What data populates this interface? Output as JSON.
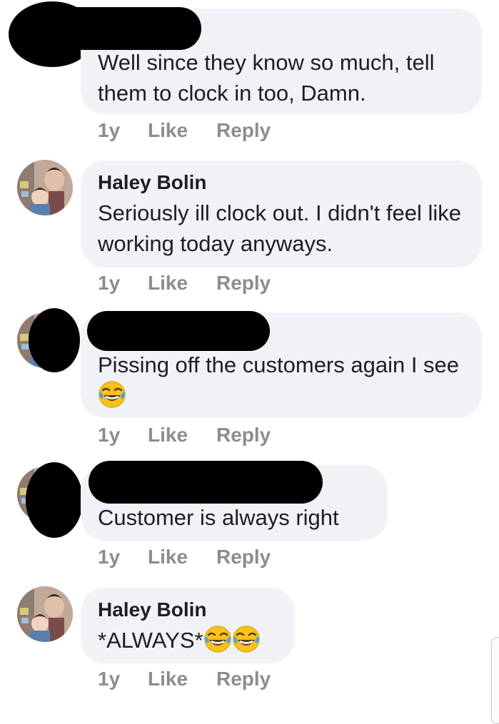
{
  "comments": [
    {
      "name": "",
      "text": "Well since they know so much, tell them to clock in too, Damn.",
      "time": "1y",
      "like": "Like",
      "reply": "Reply"
    },
    {
      "name": "Haley Bolin",
      "text": "Seriously ill clock out. I didn't feel like working today anyways.",
      "time": "1y",
      "like": "Like",
      "reply": "Reply"
    },
    {
      "name": "",
      "text": "Pissing off the customers again I see",
      "emoji": "tears-of-joy-emoji",
      "time": "1y",
      "like": "Like",
      "reply": "Reply"
    },
    {
      "name": "",
      "text": "Customer is always right",
      "time": "1y",
      "like": "Like",
      "reply": "Reply"
    },
    {
      "name": "Haley Bolin",
      "text": "*ALWAYS*",
      "emoji": "tears-of-joy-emoji",
      "time": "1y",
      "like": "Like",
      "reply": "Reply"
    }
  ],
  "colors": {
    "bubble": "#f0f2f5",
    "meta": "#8a8d91",
    "text": "#1c1e21",
    "redaction": "#000000"
  }
}
